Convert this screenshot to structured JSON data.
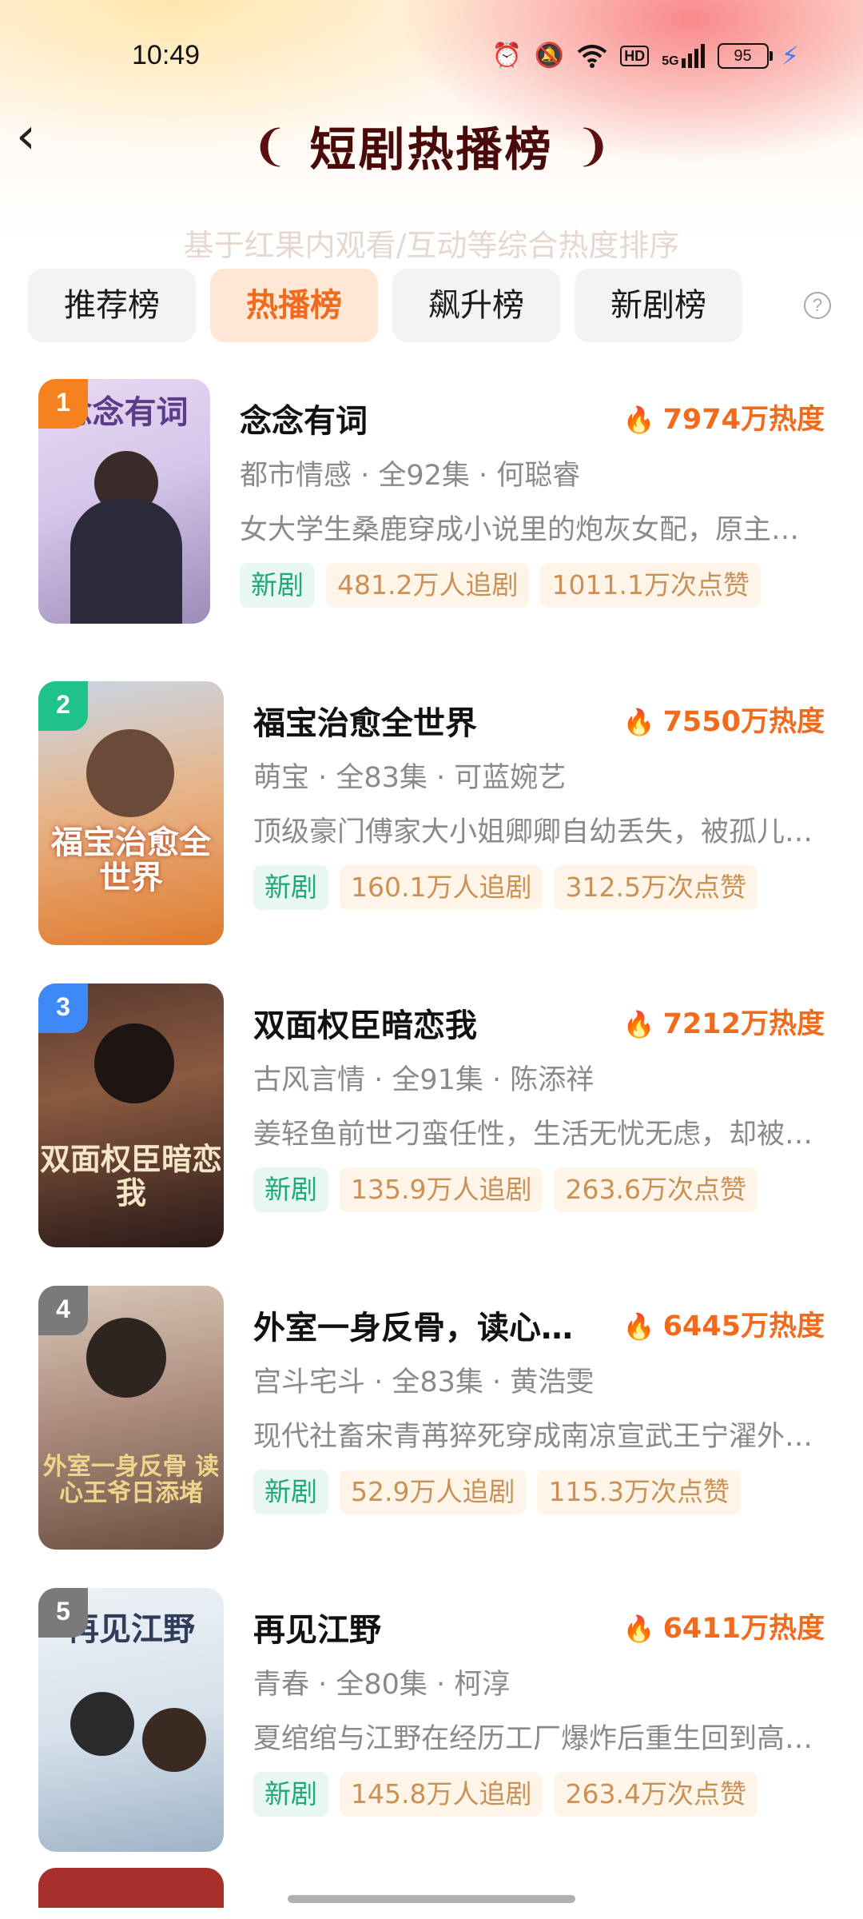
{
  "status_bar": {
    "time": "10:49",
    "network": "5G",
    "hd": "HD",
    "battery": "95"
  },
  "header": {
    "title": "短剧热播榜",
    "subtitle": "基于红果内观看/互动等综合热度排序"
  },
  "tabs": [
    {
      "label": "推荐榜",
      "active": false
    },
    {
      "label": "热播榜",
      "active": true
    },
    {
      "label": "飙升榜",
      "active": false
    },
    {
      "label": "新剧榜",
      "active": false
    }
  ],
  "items": [
    {
      "rank": "1",
      "title": "念念有词",
      "heat": "7974万热度",
      "meta": "都市情感 · 全92集 · 何聪睿",
      "desc": "女大学生桑鹿穿成小说里的炮灰女配，原主…",
      "tag_new": "新剧",
      "followers": "481.2万人追剧",
      "likes": "1011.1万次点赞",
      "cover_text": "念念有词",
      "badge_color": "#f5821f"
    },
    {
      "rank": "2",
      "title": "福宝治愈全世界",
      "heat": "7550万热度",
      "meta": "萌宝 · 全83集 · 可蓝婉艺",
      "desc": "顶级豪门傅家大小姐卿卿自幼丢失，被孤儿…",
      "tag_new": "新剧",
      "followers": "160.1万人追剧",
      "likes": "312.5万次点赞",
      "cover_text": "福宝治愈全世界",
      "badge_color": "#1fc28a"
    },
    {
      "rank": "3",
      "title": "双面权臣暗恋我",
      "heat": "7212万热度",
      "meta": "古风言情 · 全91集 · 陈添祥",
      "desc": "姜轻鱼前世刁蛮任性，生活无忧无虑，却被…",
      "tag_new": "新剧",
      "followers": "135.9万人追剧",
      "likes": "263.6万次点赞",
      "cover_text": "双面权臣暗恋我",
      "badge_color": "#3d8af7"
    },
    {
      "rank": "4",
      "title": "外室一身反骨，读心…",
      "heat": "6445万热度",
      "meta": "宫斗宅斗 · 全83集 · 黄浩雯",
      "desc": "现代社畜宋青苒猝死穿成南凉宣武王宁濯外…",
      "tag_new": "新剧",
      "followers": "52.9万人追剧",
      "likes": "115.3万次点赞",
      "cover_text": "外室一身反骨 读心王爷日添堵",
      "badge_color": "#7a7a7a"
    },
    {
      "rank": "5",
      "title": "再见江野",
      "heat": "6411万热度",
      "meta": "青春 · 全80集 · 柯淳",
      "desc": "夏绾绾与江野在经历工厂爆炸后重生回到高…",
      "tag_new": "新剧",
      "followers": "145.8万人追剧",
      "likes": "263.4万次点赞",
      "cover_text": "再见江野",
      "badge_color": "#7a7a7a"
    }
  ]
}
